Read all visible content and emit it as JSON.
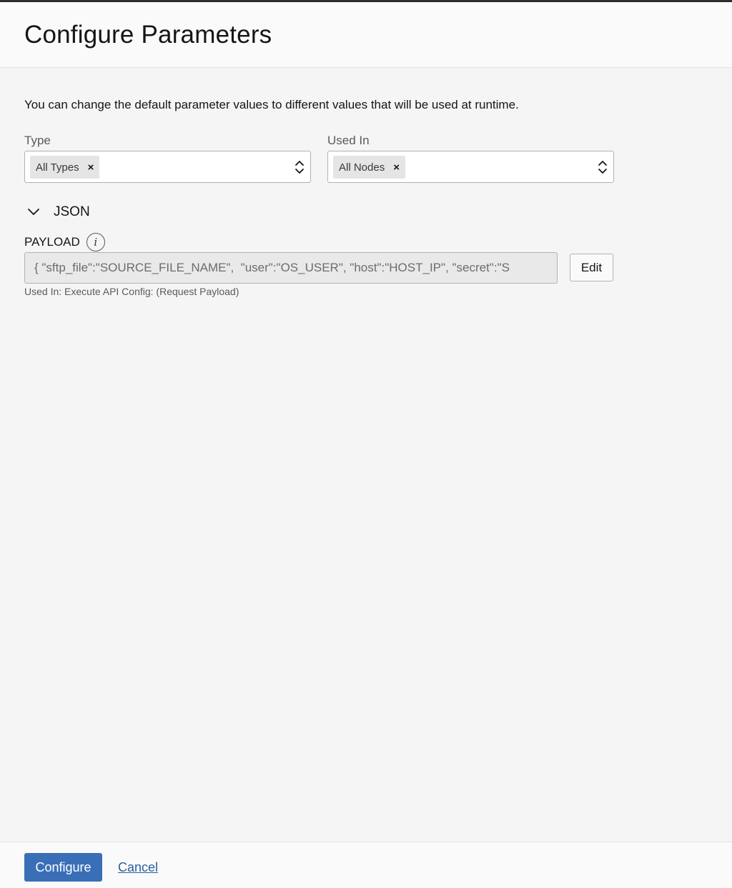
{
  "header": {
    "title": "Configure Parameters"
  },
  "description": "You can change the default parameter values to different values that will be used at runtime.",
  "filters": {
    "type": {
      "label": "Type",
      "selected_chip": "All Types",
      "remove_glyph": "×"
    },
    "used_in": {
      "label": "Used In",
      "selected_chip": "All Nodes",
      "remove_glyph": "×"
    }
  },
  "section": {
    "title": "JSON",
    "expanded": true
  },
  "payload": {
    "label": "PAYLOAD",
    "info_glyph": "i",
    "value": "{ \"sftp_file\":\"SOURCE_FILE_NAME\",  \"user\":\"OS_USER\", \"host\":\"HOST_IP\", \"secret\":\"S",
    "edit_label": "Edit",
    "helper": "Used In: Execute API Config: (Request Payload)"
  },
  "footer": {
    "configure_label": "Configure",
    "cancel_label": "Cancel"
  },
  "colors": {
    "primary": "#3a6fb7",
    "link": "#2b5f9e",
    "top_bar": "#2d2d2d"
  }
}
